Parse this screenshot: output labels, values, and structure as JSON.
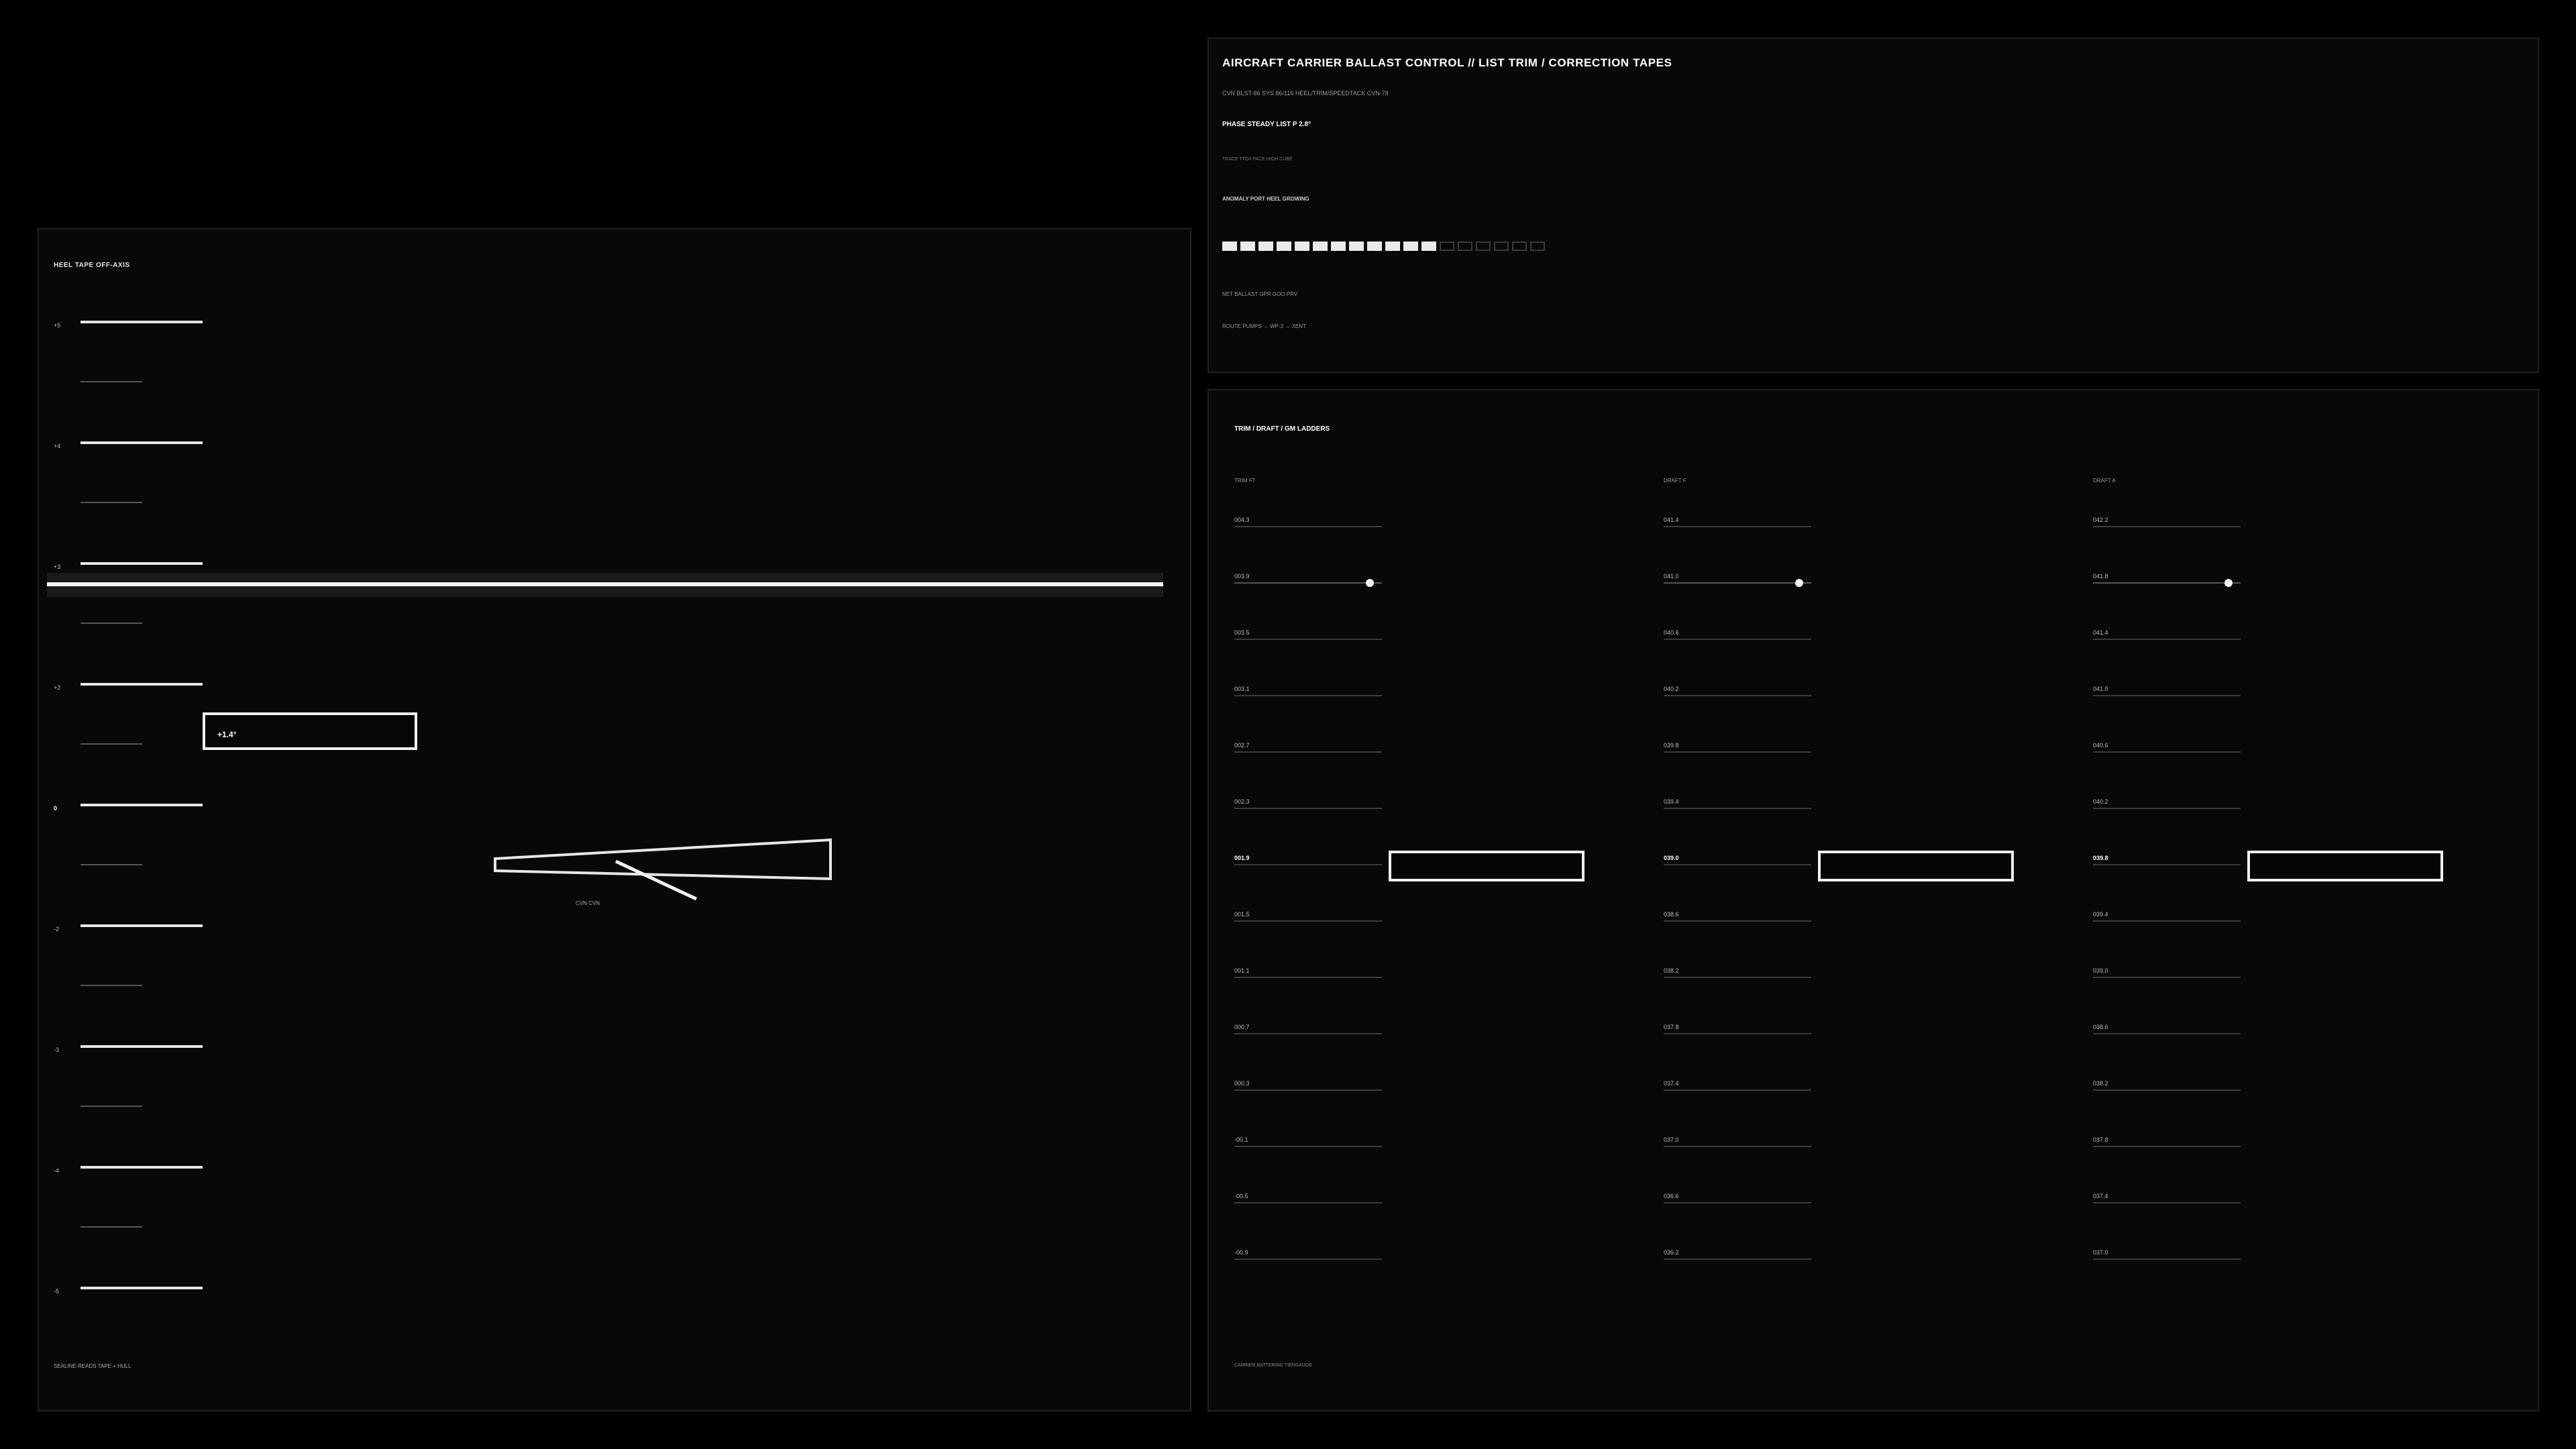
{
  "heel_panel": {
    "title": "HEEL TAPE  OFF-AXIS",
    "tick_labels": [
      "+5",
      "+4",
      "+3",
      "+2",
      "0",
      "-2",
      "-3",
      "-4",
      "-5"
    ],
    "readout": "+1.4°",
    "hull_label": "CVN  CVN",
    "footer": "SEALINE  READS TAPE + HULL"
  },
  "top_panel": {
    "title": "AIRCRAFT CARRIER BALLAST CONTROL  //  LIST TRIM / CORRECTION TAPES",
    "system_line": "CVN BLST-86   SYS 86/116   HEEL/TRIM/SPEEDTACK   CVN-78",
    "phase_line": "PHASE STEADY   LIST P 2.8°",
    "trace_line": "TRACE   TTO4  PACE   HIGH  CUBE",
    "anomaly_line": "ANOMALY  PORT HEEL GROWING",
    "segments_on": 12,
    "segments_total": 18,
    "ballast_line": "NET  BALLAST  GPR   GOO   PRV",
    "route_line": "ROUTE  PUMPS  → WP-3  → XENT"
  },
  "ladder_panel": {
    "title": "TRIM / DRAFT / GM LADDERS",
    "footer": "CARRIER BATTERING TIERGAUGE",
    "columns": [
      {
        "header": "TRIM FT",
        "values": [
          "004.3",
          "003.9",
          "003.5",
          "003.1",
          "002.7",
          "002.3",
          "001.9",
          "001.5",
          "001.1",
          "000.7",
          "000.3",
          "-00.1",
          "-00.5",
          "-00.9"
        ],
        "current_index": 6,
        "slider_index": 1,
        "slider_level": 0.92
      },
      {
        "header": "DRAFT F",
        "values": [
          "041.4",
          "041.0",
          "040.6",
          "040.2",
          "039.8",
          "039.4",
          "039.0",
          "038.6",
          "038.2",
          "037.8",
          "037.4",
          "037.0",
          "036.6",
          "036.2"
        ],
        "current_index": 6,
        "slider_index": 1,
        "slider_level": 0.92
      },
      {
        "header": "DRAFT A",
        "values": [
          "042.2",
          "041.8",
          "041.4",
          "041.0",
          "040.6",
          "040.2",
          "039.8",
          "039.4",
          "039.0",
          "038.6",
          "038.2",
          "037.8",
          "037.4",
          "037.0"
        ],
        "current_index": 6,
        "slider_index": 1,
        "slider_level": 0.92
      }
    ]
  }
}
